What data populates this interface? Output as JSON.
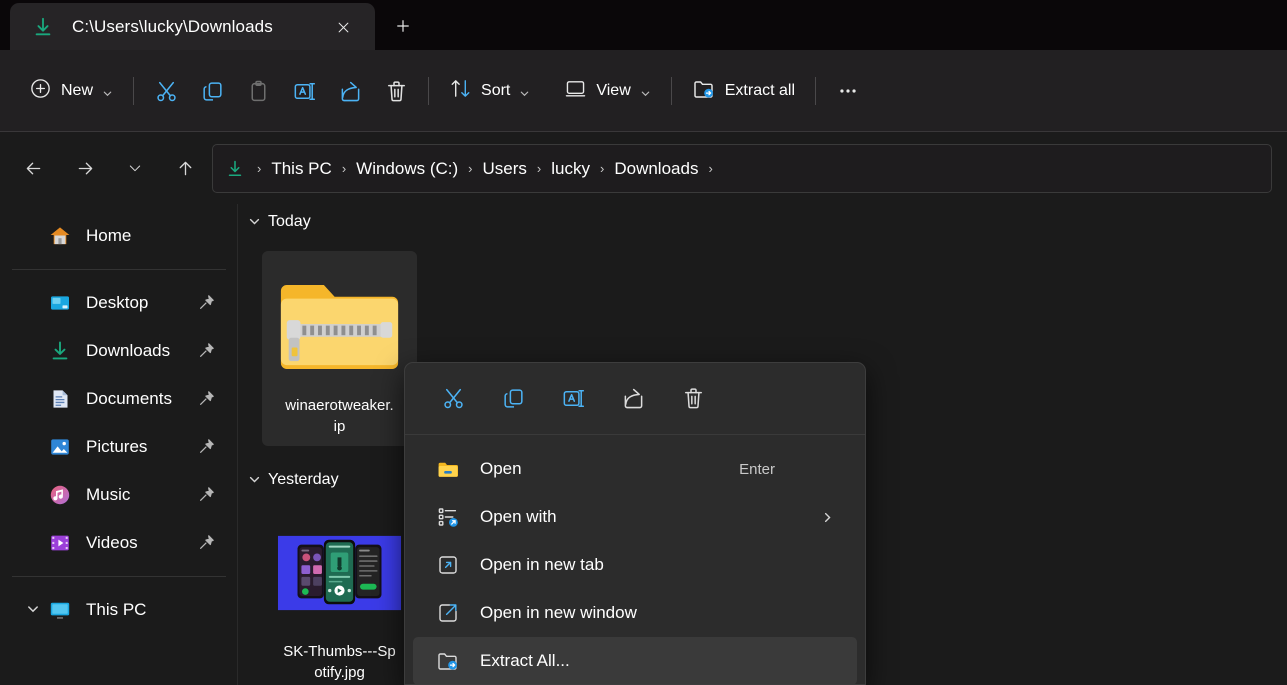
{
  "window": {
    "tab": {
      "title": "C:\\Users\\lucky\\Downloads",
      "icon": "downloads-arrow-icon",
      "close_label": "✕"
    },
    "new_tab_label": "+"
  },
  "toolbar": {
    "new_label": "New",
    "sort_label": "Sort",
    "view_label": "View",
    "extract_all_label": "Extract all",
    "overflow_label": "•••",
    "icons": [
      {
        "name": "cut-icon",
        "enabled": true
      },
      {
        "name": "copy-icon",
        "enabled": true
      },
      {
        "name": "paste-icon",
        "enabled": false
      },
      {
        "name": "rename-icon",
        "enabled": true
      },
      {
        "name": "share-icon",
        "enabled": true
      },
      {
        "name": "delete-icon",
        "enabled": true
      }
    ]
  },
  "address": {
    "back_label": "←",
    "forward_label": "→",
    "recent_label": "⌄",
    "up_label": "↑",
    "crumbs": [
      {
        "label": "This PC"
      },
      {
        "label": "Windows (C:)"
      },
      {
        "label": "Users"
      },
      {
        "label": "lucky"
      },
      {
        "label": "Downloads"
      }
    ],
    "separator": "›"
  },
  "sidebar": {
    "home": {
      "label": "Home",
      "icon": "home-icon"
    },
    "quick_access": [
      {
        "label": "Desktop",
        "icon": "desktop-icon",
        "pinned": true
      },
      {
        "label": "Downloads",
        "icon": "downloads-icon",
        "pinned": true
      },
      {
        "label": "Documents",
        "icon": "documents-icon",
        "pinned": true
      },
      {
        "label": "Pictures",
        "icon": "pictures-icon",
        "pinned": true
      },
      {
        "label": "Music",
        "icon": "music-icon",
        "pinned": true
      },
      {
        "label": "Videos",
        "icon": "videos-icon",
        "pinned": true
      }
    ],
    "this_pc": {
      "label": "This PC",
      "icon": "monitor-icon"
    }
  },
  "content": {
    "groups": [
      {
        "header": "Today",
        "files": [
          {
            "name_line1": "winaerotweaker.",
            "name_line2": "ip",
            "icon": "zip-folder-icon",
            "selected": true
          }
        ]
      },
      {
        "header": "Yesterday",
        "files": [
          {
            "name_line1": "SK-Thumbs---Sp",
            "name_line2": "otify.jpg",
            "icon": "image-thumbnail",
            "selected": false
          }
        ]
      }
    ]
  },
  "context_menu": {
    "icon_row": [
      {
        "name": "cut-icon"
      },
      {
        "name": "copy-icon"
      },
      {
        "name": "rename-icon"
      },
      {
        "name": "share-icon"
      },
      {
        "name": "delete-icon"
      }
    ],
    "items": [
      {
        "label": "Open",
        "icon": "folder-icon",
        "accel": "Enter",
        "submenu": false,
        "highlighted": false
      },
      {
        "label": "Open with",
        "icon": "open-with-icon",
        "accel": "",
        "submenu": true,
        "highlighted": false
      },
      {
        "label": "Open in new tab",
        "icon": "new-tab-icon",
        "accel": "",
        "submenu": false,
        "highlighted": false
      },
      {
        "label": "Open in new window",
        "icon": "new-window-icon",
        "accel": "",
        "submenu": false,
        "highlighted": false
      },
      {
        "label": "Extract All...",
        "icon": "extract-icon",
        "accel": "",
        "submenu": false,
        "highlighted": true
      }
    ]
  },
  "colors": {
    "accent_blue": "#4cb3f5",
    "teal": "#1aa87e",
    "titlebar": "#0a0709",
    "toolbar": "#222022",
    "body": "#1b1b1b",
    "menu": "#2c2c2c",
    "highlight": "#3a3a3a",
    "folder_yellow": "#f7c13c"
  }
}
